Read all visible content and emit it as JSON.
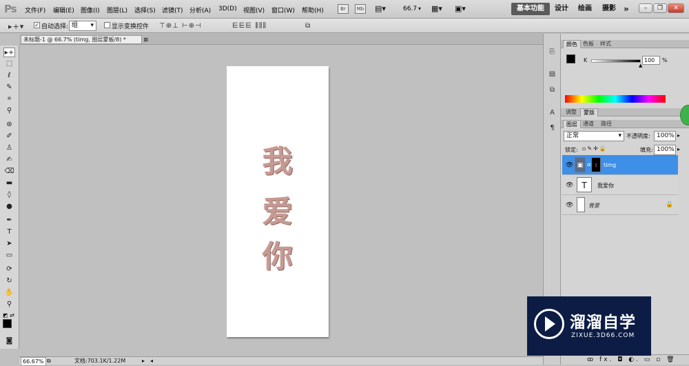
{
  "app": {
    "logo": "Ps"
  },
  "menu": [
    "文件(F)",
    "编辑(E)",
    "图像(I)",
    "图层(L)",
    "选择(S)",
    "滤镜(T)",
    "分析(A)",
    "3D(D)",
    "视图(V)",
    "窗口(W)",
    "帮助(H)"
  ],
  "appbar": {
    "bridge": "Br",
    "minibridge": "Mb",
    "zoom": "66.7"
  },
  "workspaces": [
    "基本功能",
    "设计",
    "绘画",
    "摄影"
  ],
  "workspace_more": "»",
  "options": {
    "auto_select_label": "自动选择:",
    "auto_select_value": "组",
    "show_transform_label": "显示变换控件"
  },
  "document": {
    "tab_title": "未标题-1 @ 66.7% (timg, 图层蒙板/8) *",
    "glyphs": [
      "我",
      "爱",
      "你"
    ]
  },
  "status": {
    "zoom": "66.67%",
    "doc_info": "文档:703.1K/1.22M"
  },
  "panels": {
    "color_tabs": [
      "颜色",
      "色板",
      "样式"
    ],
    "color_channel": "K",
    "color_value": "100",
    "color_unit": "%",
    "adjust_tabs": [
      "调整",
      "蒙版"
    ],
    "layer_tabs": [
      "图层",
      "通道",
      "路径"
    ],
    "blend_mode": "正常",
    "opacity_label": "不透明度:",
    "opacity_value": "100%",
    "lock_label": "锁定:",
    "fill_label": "填充:",
    "fill_value": "100%",
    "layers": [
      {
        "name": "timg",
        "selected": true
      },
      {
        "name": "我爱你",
        "selected": false
      },
      {
        "name": "背景",
        "selected": false
      }
    ],
    "bottom_icons": "ꝏ fx. ◘ ◐. ▭ ▫ 🗑"
  },
  "watermark": {
    "cn": "溜溜自学",
    "en": "ZIXUE.3D66.COM"
  },
  "colors": {
    "selection_blue": "#3d8fe8",
    "watermark_bg": "#0c1c44",
    "glyph_pink": "#c69a92"
  }
}
